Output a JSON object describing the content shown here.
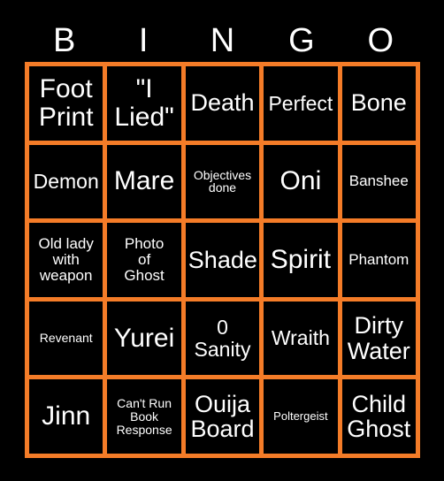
{
  "card": {
    "title_letters": [
      "B",
      "I",
      "N",
      "G",
      "O"
    ],
    "accent_color": "#f47c28",
    "background_color": "#000000",
    "text_color": "#ffffff",
    "rows": 5,
    "columns": 5
  },
  "cells": [
    {
      "text": "Foot\nPrint",
      "size": "fs-xl"
    },
    {
      "text": "\"I\nLied\"",
      "size": "fs-xl"
    },
    {
      "text": "Death",
      "size": "fs-lg"
    },
    {
      "text": "Perfect",
      "size": "fs-md"
    },
    {
      "text": "Bone",
      "size": "fs-lg"
    },
    {
      "text": "Demon",
      "size": "fs-md"
    },
    {
      "text": "Mare",
      "size": "fs-xl"
    },
    {
      "text": "Objectives\ndone",
      "size": "fs-xs"
    },
    {
      "text": "Oni",
      "size": "fs-xl"
    },
    {
      "text": "Banshee",
      "size": "fs-sm"
    },
    {
      "text": "Old lady\nwith\nweapon",
      "size": "fs-sm"
    },
    {
      "text": "Photo\nof\nGhost",
      "size": "fs-sm"
    },
    {
      "text": "Shade",
      "size": "fs-lg"
    },
    {
      "text": "Spirit",
      "size": "fs-xl"
    },
    {
      "text": "Phantom",
      "size": "fs-sm"
    },
    {
      "text": "Revenant",
      "size": "fs-xs"
    },
    {
      "text": "Yurei",
      "size": "fs-xl"
    },
    {
      "text": "0\nSanity",
      "size": "fs-md"
    },
    {
      "text": "Wraith",
      "size": "fs-md"
    },
    {
      "text": "Dirty\nWater",
      "size": "fs-lg"
    },
    {
      "text": "Jinn",
      "size": "fs-xl"
    },
    {
      "text": "Can't Run\nBook\nResponse",
      "size": "fs-xs"
    },
    {
      "text": "Ouija\nBoard",
      "size": "fs-lg"
    },
    {
      "text": "Poltergeist",
      "size": "fs-xxs"
    },
    {
      "text": "Child\nGhost",
      "size": "fs-lg"
    }
  ]
}
